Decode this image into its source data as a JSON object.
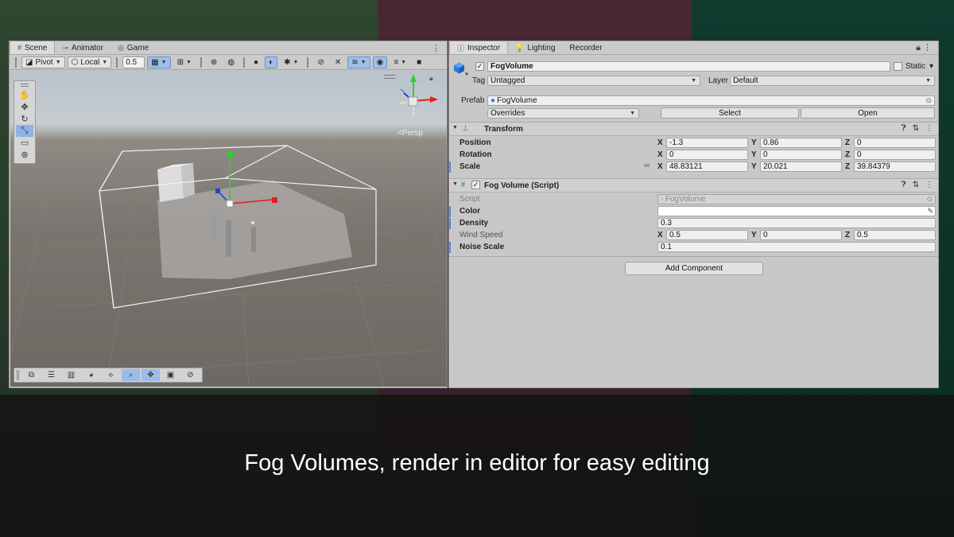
{
  "caption": "Fog Volumes, render in editor for easy editing",
  "scene": {
    "tabs": [
      {
        "icon": "#",
        "label": "Scene"
      },
      {
        "icon": "⊸",
        "label": "Animator"
      },
      {
        "icon": "◎",
        "label": "Game"
      }
    ],
    "more": "⋮",
    "toolbar": {
      "pivot_label": "Pivot",
      "local_label": "Local",
      "snap_value": "0.5"
    },
    "persp_label": "Persp"
  },
  "inspector": {
    "tabs": [
      {
        "icon": "ⓘ",
        "label": "Inspector"
      },
      {
        "icon": "💡",
        "label": "Lighting"
      },
      {
        "icon": "",
        "label": "Recorder"
      }
    ],
    "object_name": "FogVolume",
    "static_label": "Static",
    "tag_label": "Tag",
    "tag_value": "Untagged",
    "layer_label": "Layer",
    "layer_value": "Default",
    "prefab_label": "Prefab",
    "prefab_value": "FogVolume",
    "overrides_label": "Overrides",
    "select_label": "Select",
    "open_label": "Open",
    "transform": {
      "title": "Transform",
      "position_label": "Position",
      "rotation_label": "Rotation",
      "scale_label": "Scale",
      "position": {
        "x": "-1.3",
        "y": "0.86",
        "z": "0"
      },
      "rotation": {
        "x": "0",
        "y": "0",
        "z": "0"
      },
      "scale": {
        "x": "48.83121",
        "y": "20.021",
        "z": "39.84379"
      }
    },
    "fog_script": {
      "title": "Fog Volume (Script)",
      "script_label": "Script",
      "script_value": "FogVolume",
      "color_label": "Color",
      "density_label": "Density",
      "density_value": "0.3",
      "wind_label": "Wind Speed",
      "wind": {
        "x": "0.5",
        "y": "0",
        "z": "0.5"
      },
      "noise_label": "Noise Scale",
      "noise_value": "0.1"
    },
    "add_component_label": "Add Component",
    "axis_x": "X",
    "axis_y": "Y",
    "axis_z": "Z"
  },
  "colors": {
    "selection_blue": "#8fb2e6",
    "override_blue": "#3f8fe0",
    "gizmo_x": "#e0201a",
    "gizmo_y": "#30d030",
    "gizmo_z": "#2040e0"
  }
}
